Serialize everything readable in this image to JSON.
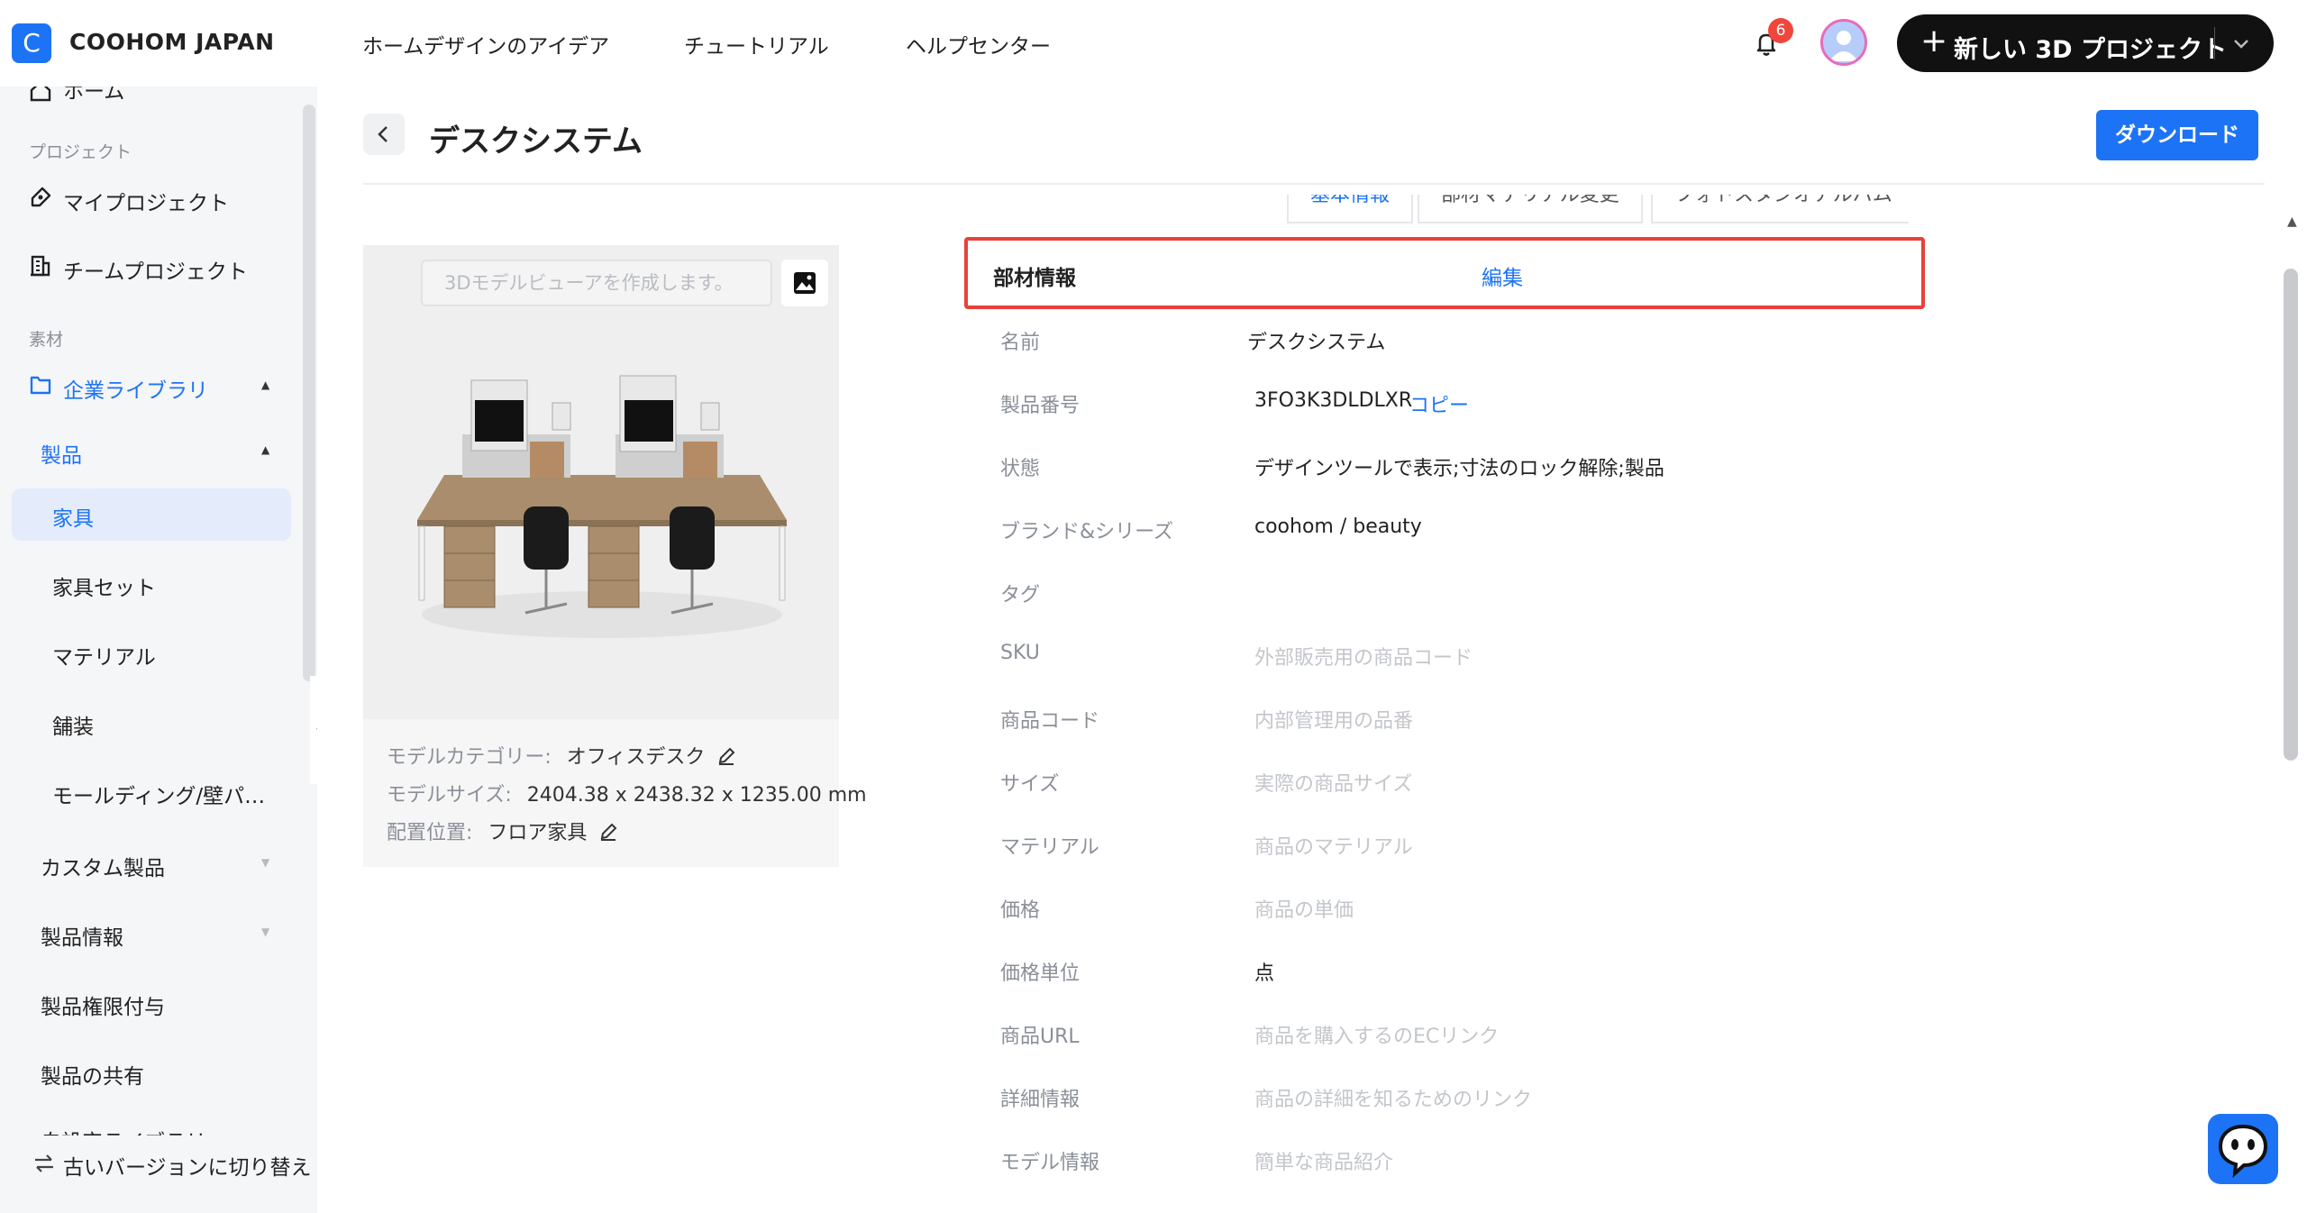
{
  "header": {
    "brand": "COOHOM JAPAN",
    "logo_letter": "C",
    "nav": [
      "ホームデザインのアイデア",
      "チュートリアル",
      "ヘルプセンター"
    ],
    "notification_count": "6",
    "new_project_label": "新しい 3D プロジェクト"
  },
  "sidebar": {
    "home_label": "ホーム",
    "section_project": "プロジェクト",
    "my_project": "マイプロジェクト",
    "team_project": "チームプロジェクト",
    "section_material": "素材",
    "enterprise_library": "企業ライブラリ",
    "products": "製品",
    "furniture": "家具",
    "furniture_set": "家具セット",
    "material": "マテリアル",
    "paving": "舗装",
    "molding": "モールディング/壁パ…",
    "custom_products": "カスタム製品",
    "product_info": "製品情報",
    "product_permission": "製品権限付与",
    "product_share": "製品の共有",
    "custom_library": "自設定ライブラリ",
    "switch_old_version": "古いバージョンに切り替え"
  },
  "page": {
    "title": "デスクシステム",
    "download_label": "ダウンロード"
  },
  "viewer": {
    "input_placeholder": "3Dモデルビューアを作成します。",
    "model_category_label": "モデルカテゴリー:",
    "model_category_value": "オフィスデスク",
    "model_size_label": "モデルサイズ:",
    "model_size_value": "2404.38 x 2438.32 x 1235.00 mm",
    "placement_label": "配置位置:",
    "placement_value": "フロア家具"
  },
  "tabs": [
    "基本情報",
    "部材マテリアル変更",
    "フォトスタジオアルバム"
  ],
  "section": {
    "title": "部材情報",
    "edit_label": "編集"
  },
  "info": {
    "name_label": "名前",
    "name_value": "デスクシステム",
    "product_no_label": "製品番号",
    "product_no_value": "3FO3K3DLDLXR",
    "copy_label": "コピー",
    "status_label": "状態",
    "status_value": "デザインツールで表示;寸法のロック解除;製品",
    "brand_label": "ブランド&シリーズ",
    "brand_value": "coohom / beauty",
    "tag_label": "タグ",
    "sku_label": "SKU",
    "sku_placeholder": "外部販売用の商品コード",
    "code_label": "商品コード",
    "code_placeholder": "内部管理用の品番",
    "size_label": "サイズ",
    "size_placeholder": "実際の商品サイズ",
    "material_label": "マテリアル",
    "material_placeholder": "商品のマテリアル",
    "price_label": "価格",
    "price_placeholder": "商品の単価",
    "price_unit_label": "価格単位",
    "price_unit_value": "点",
    "url_label": "商品URL",
    "url_placeholder": "商品を購入するのECリンク",
    "detail_label": "詳細情報",
    "detail_placeholder": "商品の詳細を知るためのリンク",
    "model_info_label": "モデル情報",
    "model_info_placeholder": "簡単な商品紹介"
  },
  "colors": {
    "accent": "#1d73f5",
    "highlight_border": "#e8413a",
    "badge": "#f0463c"
  }
}
